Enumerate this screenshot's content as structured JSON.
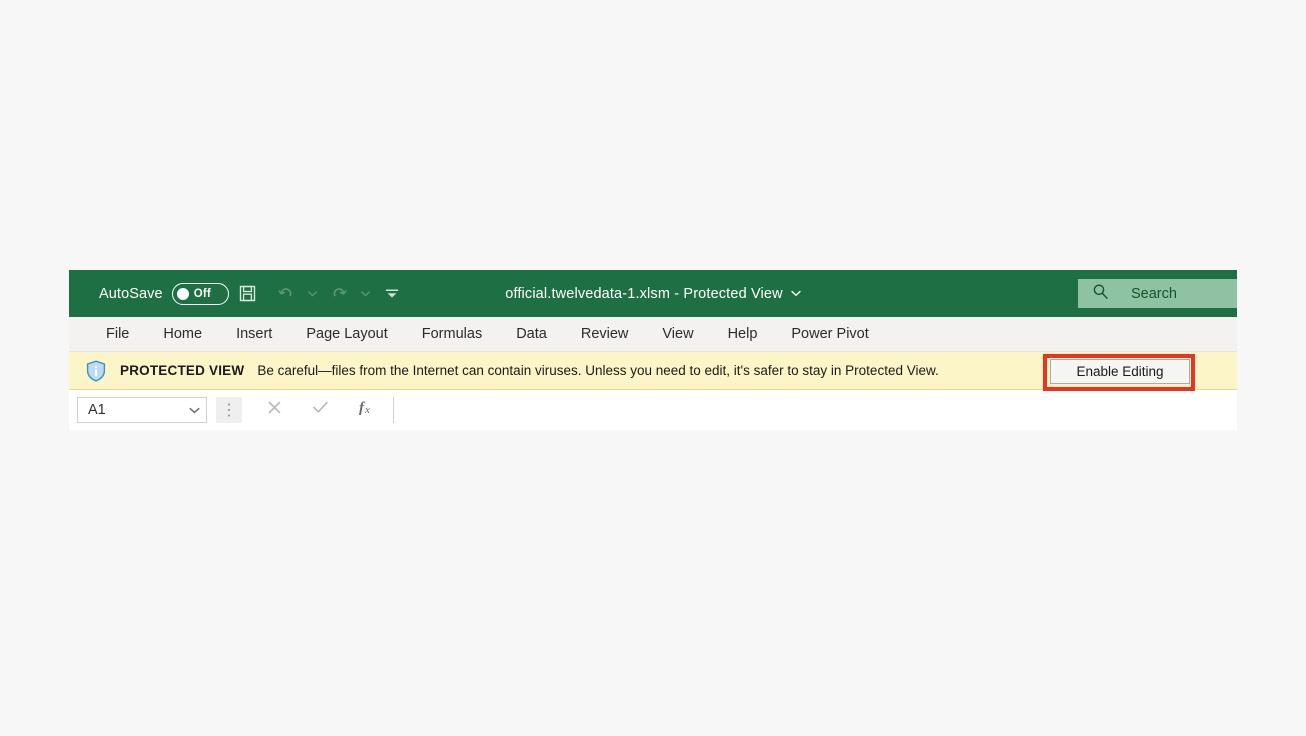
{
  "window": {
    "title_bar": {
      "autosave": {
        "label": "AutoSave",
        "state": "Off"
      },
      "quick_access": [
        {
          "name": "save-icon",
          "tooltip": "Save"
        },
        {
          "name": "undo-icon",
          "tooltip": "Undo"
        },
        {
          "name": "redo-icon",
          "tooltip": "Redo"
        },
        {
          "name": "customize-quick-access-toolbar-icon",
          "tooltip": "Customize Quick Access Toolbar"
        }
      ],
      "document_title": "official.twelvedata-1.xlsm  -  Protected View",
      "search": {
        "placeholder": "Search",
        "label": "Search"
      }
    },
    "ribbon": {
      "tabs": [
        {
          "label": "File"
        },
        {
          "label": "Home"
        },
        {
          "label": "Insert"
        },
        {
          "label": "Page Layout"
        },
        {
          "label": "Formulas"
        },
        {
          "label": "Data"
        },
        {
          "label": "Review"
        },
        {
          "label": "View"
        },
        {
          "label": "Help"
        },
        {
          "label": "Power Pivot"
        }
      ]
    },
    "protected_view": {
      "title": "PROTECTED VIEW",
      "message": "Be careful—files from the Internet can contain viruses. Unless you need to edit, it's safer to stay in Protected View.",
      "button_label": "Enable Editing"
    },
    "formula_bar": {
      "name_box_value": "A1",
      "formula_value": "",
      "cancel_label": "×",
      "enter_label": "✓",
      "insert_function_label": "fx"
    }
  },
  "colors": {
    "title_bar_green": "#1e6f43",
    "search_green": "#8fc2a2",
    "ribbon_gray": "#f3f2f1",
    "protected_view_yellow": "#fcf5c7",
    "annotation_red": "#ea3323",
    "page_background": "#f7f7f7"
  }
}
